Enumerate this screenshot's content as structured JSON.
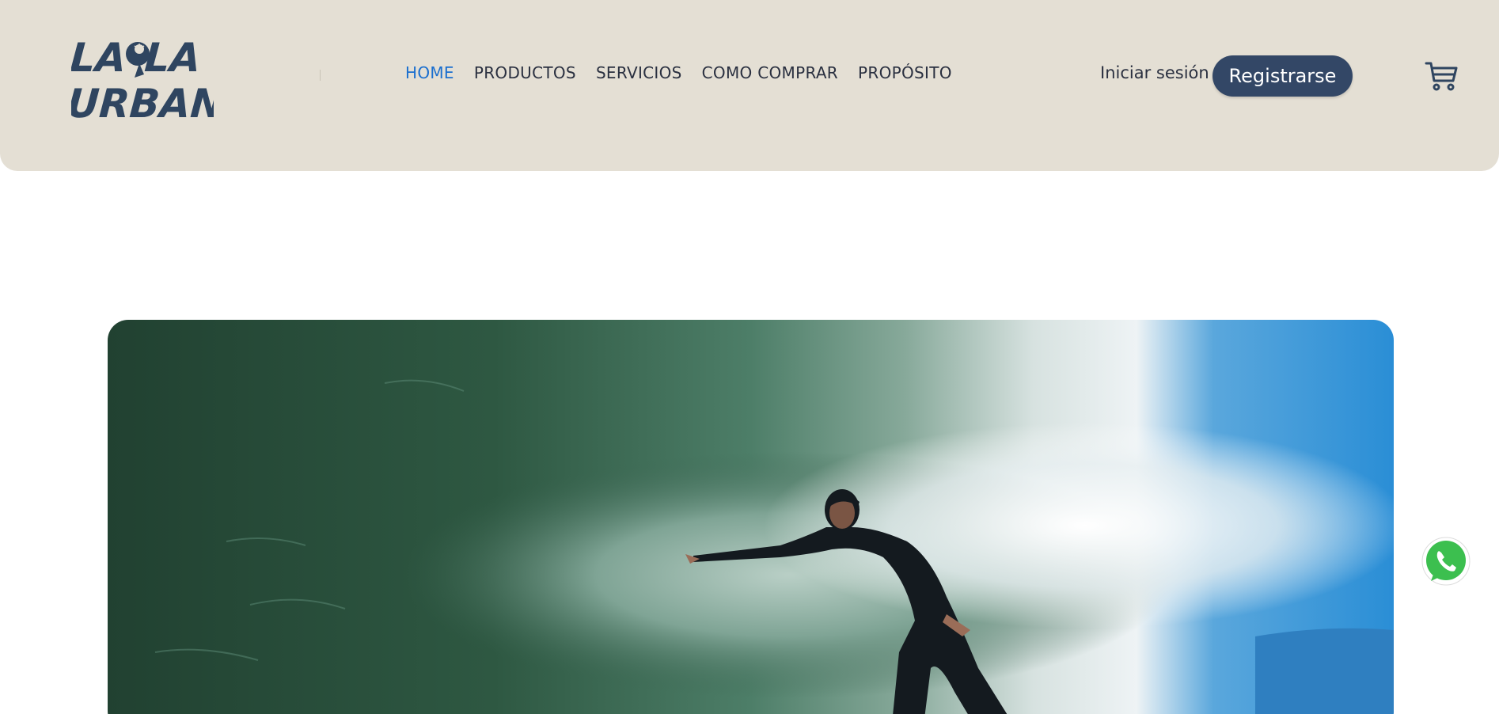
{
  "brand": {
    "logo_text": "LA OLA URBANA",
    "logo_line1": "LA OLA",
    "logo_line2": "URBANA",
    "color": "#2f4560"
  },
  "nav": {
    "items": [
      {
        "label": "HOME",
        "active": true
      },
      {
        "label": "PRODUCTOS",
        "active": false
      },
      {
        "label": "SERVICIOS",
        "active": false
      },
      {
        "label": "COMO COMPRAR",
        "active": false
      },
      {
        "label": "PROPÓSITO",
        "active": false
      }
    ],
    "active_color": "#1b6fcf"
  },
  "account": {
    "login_label": "Iniciar sesión",
    "register_label": "Registrarse",
    "register_color": "#334766"
  },
  "icons": {
    "cart": "shopping-cart-icon",
    "whatsapp": "whatsapp-icon"
  },
  "hero": {
    "image_alt": "surfer riding inside a barrel wave"
  },
  "colors": {
    "header_bg": "#e4dfd4",
    "text": "#2a3040"
  }
}
